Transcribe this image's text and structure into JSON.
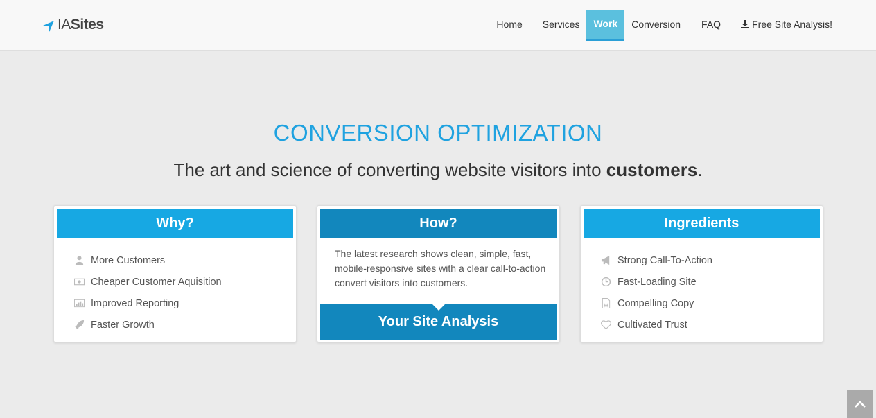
{
  "brand": {
    "part1": "IA",
    "part2": "Sites",
    "icon": "location-arrow-icon",
    "color": "#1fa2e0"
  },
  "nav": {
    "items": [
      {
        "label": "Home"
      },
      {
        "label": "Services"
      },
      {
        "label": "Work",
        "active": true
      },
      {
        "label": "Conversion"
      },
      {
        "label": "FAQ"
      },
      {
        "label": "Free Site Analysis!",
        "icon": "download-icon"
      }
    ]
  },
  "hero": {
    "title": "CONVERSION OPTIMIZATION",
    "subtitle_pre": "The art and science of converting website visitors into ",
    "subtitle_bold": "customers",
    "subtitle_post": "."
  },
  "why": {
    "title": "Why?",
    "items": [
      {
        "label": "More Customers",
        "icon": "user-icon"
      },
      {
        "label": "Cheaper Customer Aquisition",
        "icon": "money-icon"
      },
      {
        "label": "Improved Reporting",
        "icon": "bar-chart-icon"
      },
      {
        "label": "Faster Growth",
        "icon": "rocket-icon"
      }
    ]
  },
  "how": {
    "title": "How?",
    "text": "The latest research shows clean, simple, fast, mobile-responsive sites with a clear call-to-action convert visitors into customers.",
    "button": "Your Site Analysis"
  },
  "ingredients": {
    "title": "Ingredients",
    "items": [
      {
        "label": "Strong Call-To-Action",
        "icon": "bullhorn-icon"
      },
      {
        "label": "Fast-Loading Site",
        "icon": "clock-icon"
      },
      {
        "label": "Compelling Copy",
        "icon": "document-icon"
      },
      {
        "label": "Cultivated Trust",
        "icon": "heart-icon"
      }
    ]
  },
  "colors": {
    "accent": "#17a8e3",
    "accent_dark": "#1287bd",
    "nav_active": "#5bc0de",
    "background": "#ebebeb"
  },
  "scroll_top": {
    "icon": "chevron-up-icon"
  }
}
